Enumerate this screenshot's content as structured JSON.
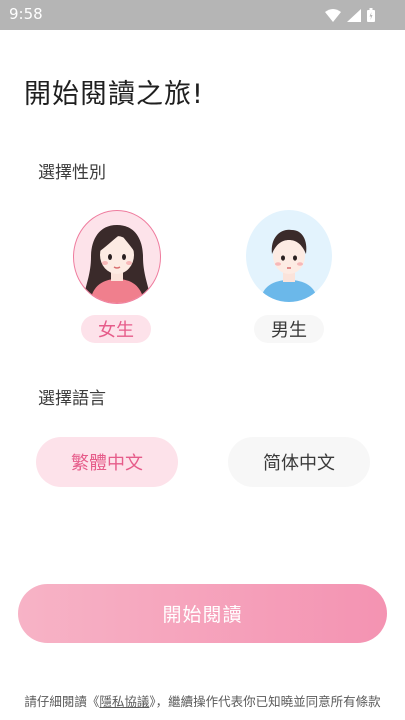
{
  "status_bar": {
    "time": "9:58",
    "icons": [
      "wifi-icon",
      "cellular-signal-icon",
      "battery-icon"
    ]
  },
  "title": "開始閱讀之旅!",
  "gender_section": {
    "label": "選擇性別",
    "options": [
      {
        "label": "女生",
        "selected": true,
        "avatar": "female-avatar-icon"
      },
      {
        "label": "男生",
        "selected": false,
        "avatar": "male-avatar-icon"
      }
    ]
  },
  "language_section": {
    "label": "選擇語言",
    "options": [
      {
        "label": "繁體中文",
        "selected": true
      },
      {
        "label": "简体中文",
        "selected": false
      }
    ]
  },
  "start_button": {
    "label": "開始閱讀"
  },
  "privacy": {
    "prefix": "請仔細閱讀《",
    "link": "隱私協議",
    "suffix": "》，繼續操作代表你已知曉並同意所有條款"
  },
  "colors": {
    "accent_pink": "#e65c8a",
    "selected_bg": "#fde2ea",
    "unselected_bg": "#f7f7f7",
    "status_bar": "#b5b5b5"
  }
}
